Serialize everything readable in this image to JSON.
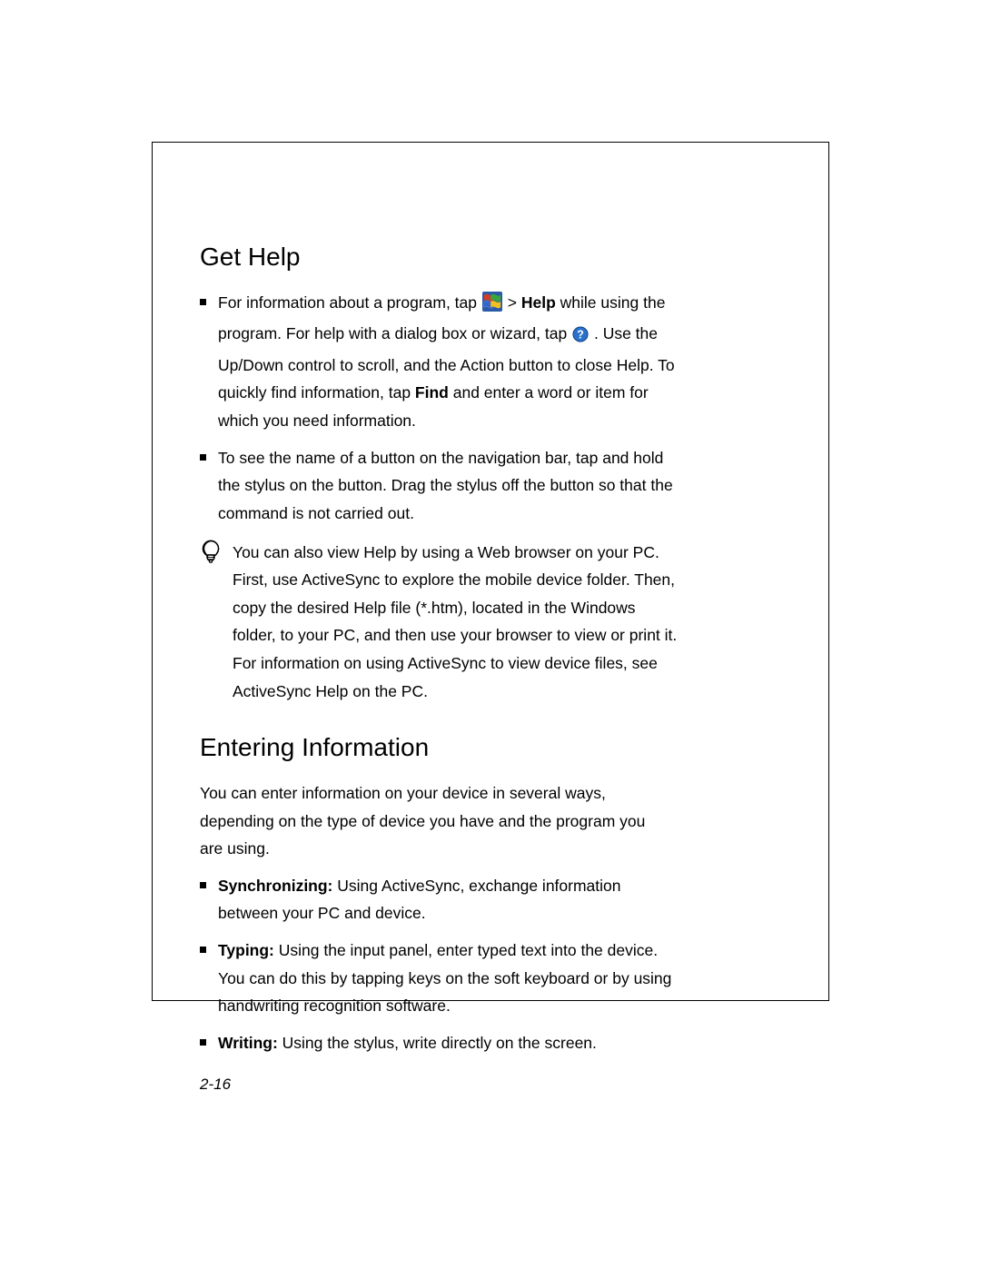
{
  "gethelp": {
    "heading": "Get Help",
    "b1": {
      "t1": "For information about a program, tap ",
      "t2": " > ",
      "bold_help": "Help",
      "t3": " while using the program. For help with a dialog box or wizard, tap",
      "t4": ". Use the Up/Down control to scroll, and the Action button to close Help. To quickly find information, tap ",
      "bold_find": "Find",
      "t5": " and enter a word or item for which you need information."
    },
    "b2": "To see the name of a button on the navigation bar, tap and hold the stylus on the button. Drag the stylus off the button so that the command is not carried out.",
    "tip": "You can also view Help by using a Web browser on your PC. First, use ActiveSync to explore the mobile device folder. Then, copy the desired Help file (*.htm), located in the Windows folder, to your PC, and then use your browser to view or print it. For information on using ActiveSync to view device files, see ActiveSync Help on the PC."
  },
  "entering": {
    "heading": "Entering Information",
    "intro": "You can enter information on your device in several ways, depending on the type of device you have and the program you are using.",
    "li1": {
      "bold": "Synchronizing:",
      "rest": " Using ActiveSync, exchange information between your PC and device."
    },
    "li2": {
      "bold": "Typing:",
      "rest": " Using the input panel, enter typed text into the device. You can do this by tapping keys on the soft keyboard or by using handwriting recognition software."
    },
    "li3": {
      "bold": "Writing:",
      "rest": " Using the stylus, write directly on the screen."
    }
  },
  "page_number": "2-16"
}
